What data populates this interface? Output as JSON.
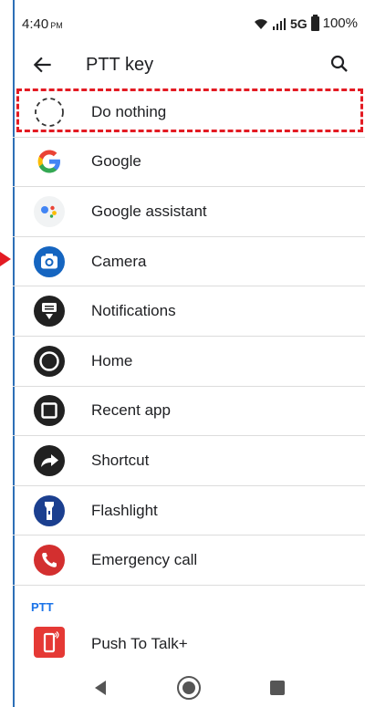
{
  "status": {
    "time": "4:40",
    "ampm": "PM",
    "network": "5G",
    "battery": "100%"
  },
  "header": {
    "title": "PTT key"
  },
  "items": [
    {
      "label": "Do nothing",
      "icon": "dashed-circle-icon"
    },
    {
      "label": "Google",
      "icon": "google-g-icon"
    },
    {
      "label": "Google assistant",
      "icon": "google-assistant-icon"
    },
    {
      "label": "Camera",
      "icon": "camera-icon"
    },
    {
      "label": "Notifications",
      "icon": "notifications-icon"
    },
    {
      "label": "Home",
      "icon": "home-circle-icon"
    },
    {
      "label": "Recent app",
      "icon": "recent-apps-icon"
    },
    {
      "label": "Shortcut",
      "icon": "shortcut-arrow-icon"
    },
    {
      "label": "Flashlight",
      "icon": "flashlight-icon"
    },
    {
      "label": "Emergency call",
      "icon": "phone-icon"
    }
  ],
  "section": {
    "label": "PTT"
  },
  "ptt_item": {
    "label": "Push To Talk+",
    "icon": "push-to-talk-icon"
  },
  "colors": {
    "highlight": "#e31b23",
    "accent": "#1a73e8",
    "camera": "#1565c0",
    "flashlight": "#1b3f8f",
    "emergency": "#d32f2f",
    "ptt": "#e53935"
  }
}
